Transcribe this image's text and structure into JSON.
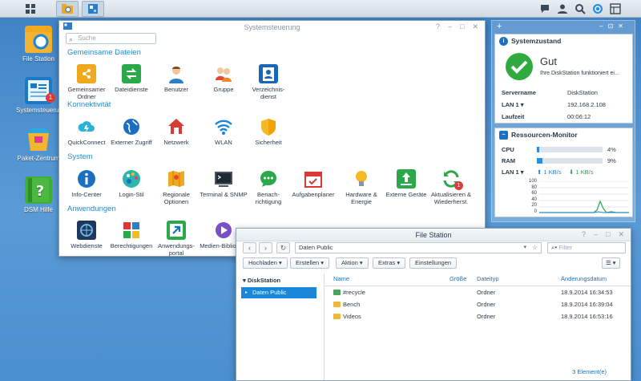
{
  "taskbar": {
    "icons": [
      "main-menu-icon",
      "file-station-icon",
      "control-panel-icon",
      "chat-icon",
      "user-icon",
      "search-icon",
      "notification-icon",
      "widgets-icon"
    ]
  },
  "desktop": {
    "icons": [
      {
        "label": "File Station",
        "icon": "file-station-icon"
      },
      {
        "label": "Systemsteuerung",
        "icon": "control-panel-icon",
        "badge": "1"
      },
      {
        "label": "Paket-Zentrum",
        "icon": "package-center-icon"
      },
      {
        "label": "DSM Hilfe",
        "icon": "help-icon"
      }
    ]
  },
  "control_panel": {
    "title": "Systemsteuerung",
    "search_placeholder": "Suche",
    "sections": {
      "shared": "Gemeinsame Dateien",
      "connectivity": "Konnektivität",
      "system": "System",
      "apps": "Anwendungen"
    },
    "items": {
      "shared_folder": "Gemeinsamer Ordner",
      "file_services": "Dateidienste",
      "user": "Benutzer",
      "group": "Gruppe",
      "directory": "Verzeichnis-dienst",
      "quickconnect": "QuickConnect",
      "external_access": "Externer Zugriff",
      "network": "Netzwerk",
      "wlan": "WLAN",
      "security": "Sicherheit",
      "info": "Info-Center",
      "login_style": "Login-Stil",
      "regional": "Regionale Optionen",
      "terminal": "Terminal & SNMP",
      "notification": "Benach-richtigung",
      "task_scheduler": "Aufgabenplaner",
      "hardware": "Hardware & Energie",
      "external_devices": "Externe Geräte",
      "update": "Aktualisieren & Wiederherst.",
      "web_services": "Webdienste",
      "privileges": "Berechtigungen",
      "app_portal": "Anwendungs-portal",
      "media_library": "Medien-Bibliothek"
    },
    "update_badge": "1"
  },
  "system_health": {
    "title": "Systemzustand",
    "status": "Gut",
    "status_detail": "Ihre DiskStation funktioniert ei...",
    "rows": [
      {
        "k": "Servername",
        "v": "DiskStation"
      },
      {
        "k": "LAN 1 ▾",
        "v": "192.168.2.108"
      },
      {
        "k": "Laufzeit",
        "v": "00:06:12"
      }
    ]
  },
  "resource_monitor": {
    "title": "Ressourcen-Monitor",
    "cpu_label": "CPU",
    "cpu_value": "4%",
    "cpu_pct": 4,
    "ram_label": "RAM",
    "ram_value": "9%",
    "ram_pct": 9,
    "lan_label": "LAN 1 ▾",
    "up": "1 KB/s",
    "down": "1 KB/s",
    "ticks": [
      "100",
      "80",
      "60",
      "40",
      "20",
      "0"
    ]
  },
  "file_station": {
    "title": "File Station",
    "path": "Daten Public",
    "filter_placeholder": "Filter",
    "toolbar": [
      "Hochladen ▾",
      "Erstellen ▾",
      "Aktion ▾",
      "Extras ▾",
      "Einstellungen"
    ],
    "tree_root": "DiskStation",
    "tree_selected": "Daten Public",
    "columns": {
      "name": "Name",
      "size": "Größe",
      "type": "Dateityp",
      "modified": "Änderungsdatum"
    },
    "rows": [
      {
        "name": "#recycle",
        "type": "Ordner",
        "modified": "18.9.2014 16:34:53"
      },
      {
        "name": "Bench",
        "type": "Ordner",
        "modified": "18.9.2014 16:39:04"
      },
      {
        "name": "Videos",
        "type": "Ordner",
        "modified": "18.9.2014 16:53:16"
      }
    ],
    "status": "3 Element(e)"
  }
}
